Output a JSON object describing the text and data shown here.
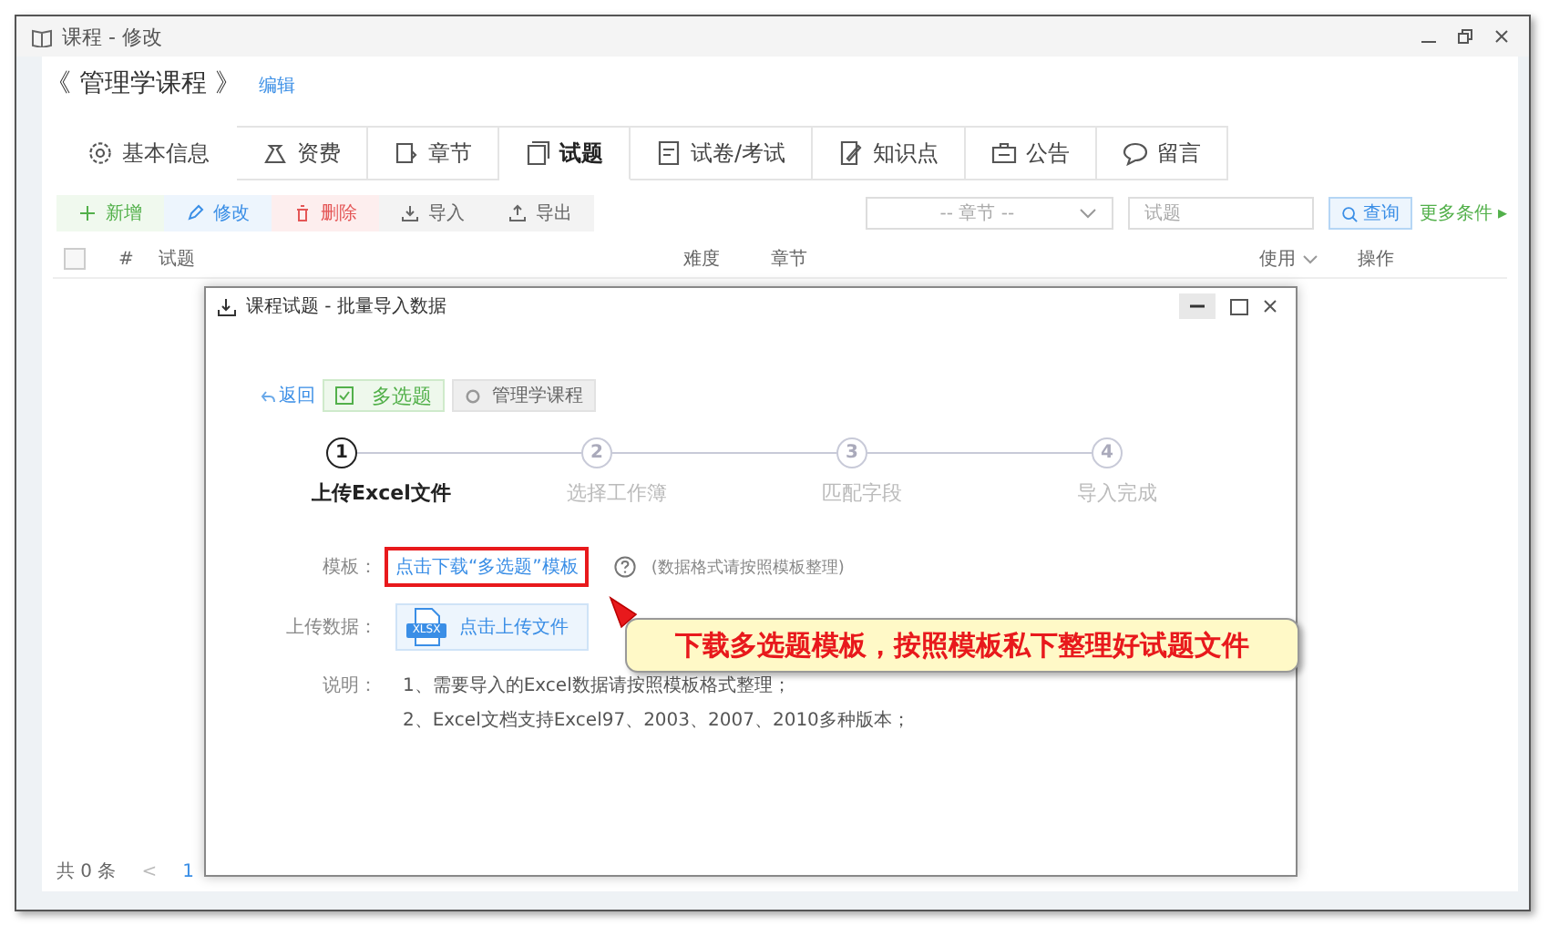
{
  "window": {
    "title": "课程 - 修改"
  },
  "course": {
    "title": "《 管理学课程 》",
    "edit_link": "编辑"
  },
  "tabs": [
    {
      "label": "基本信息",
      "selected": false
    },
    {
      "label": "资费",
      "selected": false
    },
    {
      "label": "章节",
      "selected": false
    },
    {
      "label": "试题",
      "selected": true
    },
    {
      "label": "试卷/考试",
      "selected": false
    },
    {
      "label": "知识点",
      "selected": false
    },
    {
      "label": "公告",
      "selected": false
    },
    {
      "label": "留言",
      "selected": false
    }
  ],
  "toolbar": {
    "buttons": [
      {
        "label": "新增",
        "kind": "add"
      },
      {
        "label": "修改",
        "kind": "edit"
      },
      {
        "label": "删除",
        "kind": "delete"
      },
      {
        "label": "导入",
        "kind": "import"
      },
      {
        "label": "导出",
        "kind": "export"
      }
    ],
    "chapter_select": {
      "placeholder": "-- 章节 --"
    },
    "search": {
      "placeholder": "试题"
    },
    "query_button": "查询",
    "more_link": "更多条件 ▸"
  },
  "table": {
    "select_all": {
      "checked": false
    },
    "columns": [
      "#",
      "试题",
      "难度",
      "章节",
      "使用",
      "操作"
    ]
  },
  "pagination": {
    "total": "共 0 条",
    "prev": "<",
    "current": "1"
  },
  "dialog": {
    "title": "课程试题 - 批量导入数据",
    "back_link": "返回",
    "tags": [
      {
        "label": "多选题",
        "kind": "type"
      },
      {
        "label": "管理学课程",
        "kind": "course"
      }
    ],
    "steps": [
      {
        "number": "1",
        "label": "上传Excel文件",
        "active": true
      },
      {
        "number": "2",
        "label": "选择工作簿",
        "active": false
      },
      {
        "number": "3",
        "label": "匹配字段",
        "active": false
      },
      {
        "number": "4",
        "label": "导入完成",
        "active": false
      }
    ],
    "template": {
      "label": "模板：",
      "link": "点击下载“多选题”模板",
      "hint": "(数据格式请按照模板整理)"
    },
    "upload": {
      "label": "上传数据：",
      "button": "点击上传文件",
      "file_badge": "XLSX"
    },
    "notes": {
      "label": "说明：",
      "lines": [
        "1、需要导入的Excel数据请按照模板格式整理；",
        "2、Excel文档支持Excel97、2003、2007、2010多种版本；"
      ]
    }
  },
  "annotation": {
    "text": "下载多选题模板，按照模板私下整理好试题文件"
  }
}
